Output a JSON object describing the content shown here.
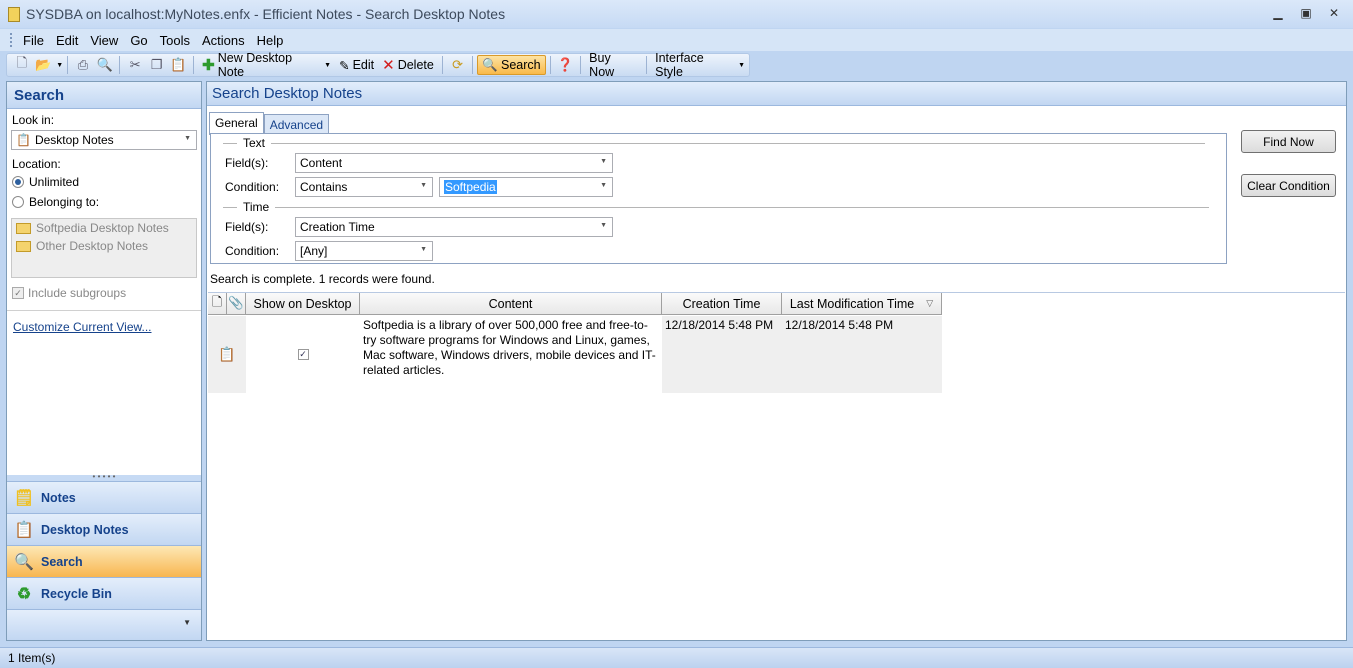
{
  "window": {
    "title": "SYSDBA on localhost:MyNotes.enfx - Efficient Notes - Search Desktop Notes"
  },
  "menu": [
    "File",
    "Edit",
    "View",
    "Go",
    "Tools",
    "Actions",
    "Help"
  ],
  "toolbar": {
    "new_desktop_note": "New Desktop Note",
    "edit": "Edit",
    "delete": "Delete",
    "search": "Search",
    "buy_now": "Buy Now",
    "interface_style": "Interface Style"
  },
  "left": {
    "header": "Search",
    "look_in_label": "Look in:",
    "look_in_value": "Desktop Notes",
    "location_label": "Location:",
    "opt_unlimited": "Unlimited",
    "opt_belonging": "Belonging to:",
    "folders": [
      "Softpedia Desktop Notes",
      "Other Desktop Notes"
    ],
    "include_subgroups": "Include subgroups",
    "customize_link": "Customize Current View...",
    "nav": [
      "Notes",
      "Desktop Notes",
      "Search",
      "Recycle Bin"
    ]
  },
  "main": {
    "header": "Search Desktop Notes",
    "tabs": [
      "General",
      "Advanced"
    ],
    "text_group": "Text",
    "time_group": "Time",
    "fields_label": "Field(s):",
    "condition_label": "Condition:",
    "text_field_value": "Content",
    "text_condition_value": "Contains",
    "text_search_value": "Softpedia",
    "time_field_value": "Creation Time",
    "time_condition_value": "[Any]",
    "find_now": "Find Now",
    "clear_condition": "Clear Condition",
    "status_message": "Search is complete. 1 records were found."
  },
  "grid": {
    "columns": [
      "Show on Desktop",
      "Content",
      "Creation Time",
      "Last Modification Time"
    ],
    "rows": [
      {
        "show_on_desktop": true,
        "content": "Softpedia is a library of over 500,000 free and free-to-try software programs for Windows and Linux, games, Mac software, Windows drivers, mobile devices and IT-related articles.",
        "creation_time": "12/18/2014 5:48 PM",
        "last_modification_time": "12/18/2014 5:48 PM"
      }
    ]
  },
  "statusbar": {
    "text": "1 Item(s)"
  }
}
